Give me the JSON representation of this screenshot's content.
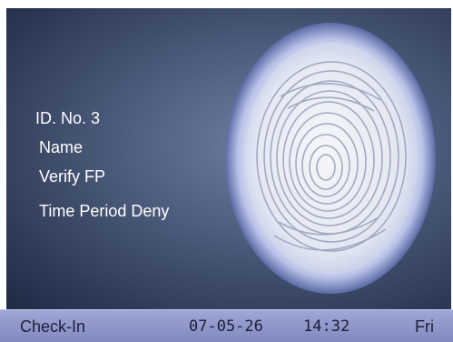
{
  "info": {
    "id_line": "ID. No.  3",
    "name_label": "Name",
    "verify_line": "Verify   FP",
    "status_message": "Time Period Deny"
  },
  "status_bar": {
    "mode": "Check-In",
    "date": "07-05-26",
    "time": "14:32",
    "day": "Fri"
  },
  "fingerprint_icon": "fingerprint-icon",
  "colors": {
    "screen_bg": "#3a4766",
    "status_bar": "#8e96cc",
    "text": "#ffffff"
  }
}
